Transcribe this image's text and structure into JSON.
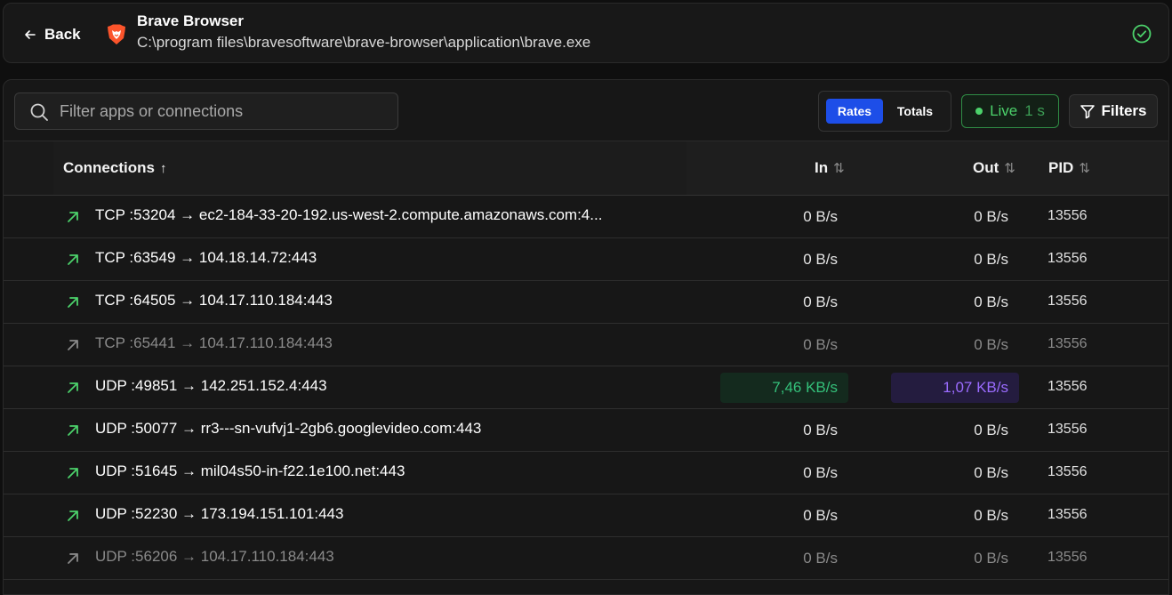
{
  "header": {
    "back_label": "Back",
    "app_name": "Brave Browser",
    "app_path": "C:\\program files\\bravesoftware\\brave-browser\\application\\brave.exe",
    "icon": "brave-lion-icon",
    "status_icon": "check-circle-icon",
    "colors": {
      "brand": "#fb542b",
      "status_ok": "#4cd26b"
    }
  },
  "toolbar": {
    "search_placeholder": "Filter apps or connections",
    "search_value": "",
    "mode_rates": "Rates",
    "mode_totals": "Totals",
    "active_mode": "Rates",
    "live_label": "Live",
    "live_interval": "1 s",
    "filters_label": "Filters"
  },
  "table": {
    "columns": {
      "connections": "Connections",
      "in": "In",
      "out": "Out",
      "pid": "PID"
    },
    "sort_column": "connections",
    "sort_dir": "asc",
    "rows": [
      {
        "connection": "TCP :53204 → ec2-184-33-20-192.us-west-2.compute.amazonaws.com:4...",
        "in": "0 B/s",
        "out": "0 B/s",
        "pid": "13556",
        "dim": false,
        "active_in": false,
        "active_out": false
      },
      {
        "connection": "TCP :63549 → 104.18.14.72:443",
        "in": "0 B/s",
        "out": "0 B/s",
        "pid": "13556",
        "dim": false,
        "active_in": false,
        "active_out": false
      },
      {
        "connection": "TCP :64505 → 104.17.110.184:443",
        "in": "0 B/s",
        "out": "0 B/s",
        "pid": "13556",
        "dim": false,
        "active_in": false,
        "active_out": false
      },
      {
        "connection": "TCP :65441 → 104.17.110.184:443",
        "in": "0 B/s",
        "out": "0 B/s",
        "pid": "13556",
        "dim": true,
        "active_in": false,
        "active_out": false
      },
      {
        "connection": "UDP :49851 → 142.251.152.4:443",
        "in": "7,46 KB/s",
        "out": "1,07 KB/s",
        "pid": "13556",
        "dim": false,
        "active_in": true,
        "active_out": true
      },
      {
        "connection": "UDP :50077 → rr3---sn-vufvj1-2gb6.googlevideo.com:443",
        "in": "0 B/s",
        "out": "0 B/s",
        "pid": "13556",
        "dim": false,
        "active_in": false,
        "active_out": false
      },
      {
        "connection": "UDP :51645 → mil04s50-in-f22.1e100.net:443",
        "in": "0 B/s",
        "out": "0 B/s",
        "pid": "13556",
        "dim": false,
        "active_in": false,
        "active_out": false
      },
      {
        "connection": "UDP :52230 → 173.194.151.101:443",
        "in": "0 B/s",
        "out": "0 B/s",
        "pid": "13556",
        "dim": false,
        "active_in": false,
        "active_out": false
      },
      {
        "connection": "UDP :56206 → 104.17.110.184:443",
        "in": "0 B/s",
        "out": "0 B/s",
        "pid": "13556",
        "dim": true,
        "active_in": false,
        "active_out": false
      }
    ]
  },
  "colors": {
    "accent": "#1d4ee8",
    "live_green": "#4cd26b",
    "rate_in": "#34c07a",
    "rate_out": "#9b6cff",
    "outbound_arrow": "#4cd26b",
    "dim_arrow": "#8a8a8a"
  }
}
